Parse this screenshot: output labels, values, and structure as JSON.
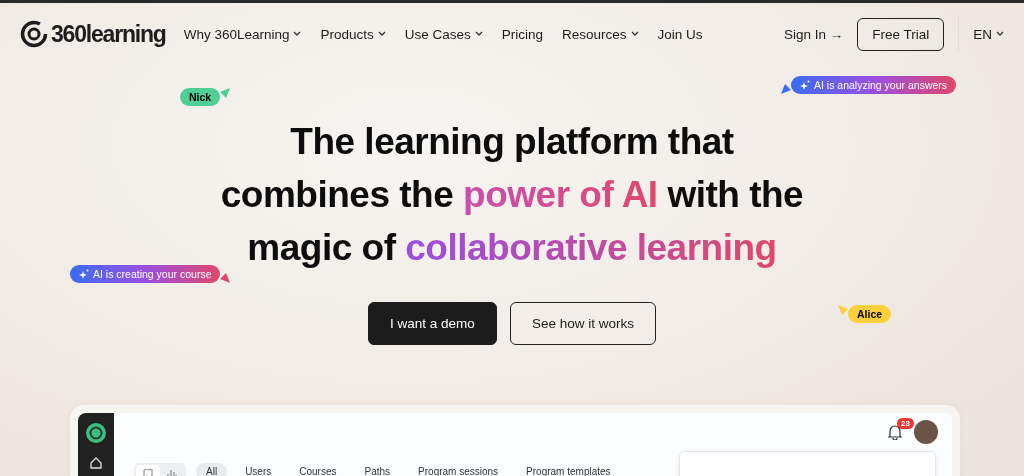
{
  "nav": {
    "logo": "360learning",
    "items": [
      {
        "label": "Why 360Learning",
        "dropdown": true
      },
      {
        "label": "Products",
        "dropdown": true
      },
      {
        "label": "Use Cases",
        "dropdown": true
      },
      {
        "label": "Pricing",
        "dropdown": false
      },
      {
        "label": "Resources",
        "dropdown": true
      },
      {
        "label": "Join Us",
        "dropdown": false
      }
    ],
    "sign_in": "Sign In",
    "sign_in_arrow": "→",
    "free_trial": "Free Trial",
    "language": "EN"
  },
  "hero": {
    "lines": [
      [
        {
          "text": "The learning platform that",
          "kind": "plain"
        }
      ],
      [
        {
          "text": "combines the ",
          "kind": "plain"
        },
        {
          "text": "power of AI",
          "kind": "pink"
        },
        {
          "text": " with the",
          "kind": "plain"
        }
      ],
      [
        {
          "text": "magic of ",
          "kind": "plain"
        },
        {
          "text": "collaborative learning",
          "kind": "purple"
        }
      ]
    ],
    "buttons": [
      {
        "label": "I want a demo",
        "kind": "primary"
      },
      {
        "label": "See how it works",
        "kind": "secondary"
      }
    ]
  },
  "tags": [
    {
      "label": "Nick",
      "kind": "cursor",
      "color": "#4fcf95"
    },
    {
      "label": "AI is analyzing your answers",
      "kind": "ai"
    },
    {
      "label": "AI is creating your course",
      "kind": "ai"
    },
    {
      "label": "Alice",
      "kind": "cursor",
      "color": "#fcd03c"
    }
  ],
  "dashboard": {
    "notification_count": "23",
    "views": [
      {
        "selected": true
      },
      {
        "selected": false
      }
    ],
    "filters": [
      {
        "label": "All",
        "selected": true
      },
      {
        "label": "Users",
        "selected": false
      },
      {
        "label": "Courses",
        "selected": false
      },
      {
        "label": "Paths",
        "selected": false
      },
      {
        "label": "Program sessions",
        "selected": false
      },
      {
        "label": "Program templates",
        "selected": false
      }
    ]
  }
}
